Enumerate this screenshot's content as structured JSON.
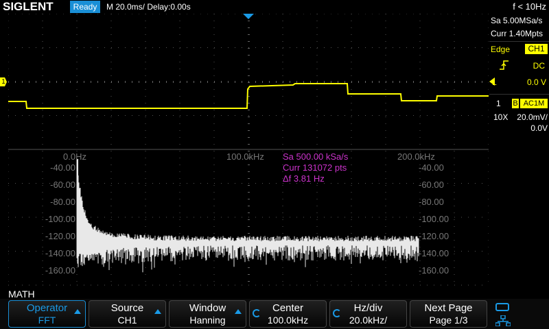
{
  "header": {
    "brand": "SIGLENT",
    "status": "Ready",
    "timebase": "M 20.0ms/ Delay:0.00s",
    "freq": "f < 10Hz"
  },
  "acquisition": {
    "sample_rate": "Sa 5.00MSa/s",
    "memory": "Curr 1.40Mpts"
  },
  "trigger": {
    "type": "Edge",
    "source": "CH1",
    "coupling": "DC",
    "level_label": "L",
    "level": "0.0 V"
  },
  "channel": {
    "number": "1",
    "bandwidth": "B",
    "coupling": "AC1M",
    "probe": "10X",
    "scale": "20.0mV/",
    "offset": "0.0V"
  },
  "marker": {
    "ch1": "1"
  },
  "fft": {
    "freq_labels": [
      "0.0Hz",
      "100.0kHz",
      "200.0kHz"
    ],
    "db_labels": [
      "-40.00",
      "-60.00",
      "-80.00",
      "-100.00",
      "-120.00",
      "-140.00",
      "-160.00"
    ],
    "info_sa": "Sa 500.00 kSa/s",
    "info_curr": "Curr 131072 pts",
    "info_df": "Δf 3.81 Hz"
  },
  "math_label": "MATH",
  "menu": [
    {
      "title": "Operator",
      "value": "FFT"
    },
    {
      "title": "Source",
      "value": "CH1"
    },
    {
      "title": "Window",
      "value": "Hanning"
    },
    {
      "title": "Center",
      "value": "100.0kHz"
    },
    {
      "title": "Hz/div",
      "value": "20.0kHz/"
    },
    {
      "title": "Next Page",
      "value": "Page 1/3"
    }
  ],
  "colors": {
    "ch1": "#ffff00",
    "math": "#cc33cc",
    "accent": "#1a8fd6",
    "spectrum": "#e8e8e8",
    "grid": "#3a3a3a"
  }
}
